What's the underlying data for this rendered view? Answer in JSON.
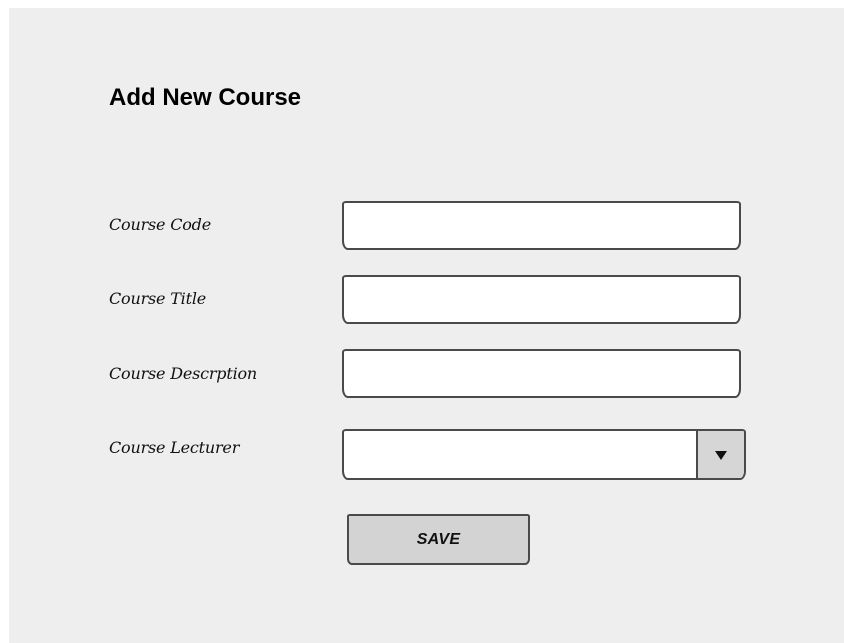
{
  "form": {
    "title": "Add New Course",
    "fields": [
      {
        "label": "Course Code",
        "value": "",
        "type": "text"
      },
      {
        "label": "Course Title",
        "value": "",
        "type": "text"
      },
      {
        "label": "Course Descrption",
        "value": "",
        "type": "text"
      },
      {
        "label": "Course Lecturer",
        "value": "",
        "type": "select",
        "icon": "triangle-down-icon"
      }
    ],
    "save_label": "SAVE"
  },
  "colors": {
    "panel_background": "#eeeeee",
    "input_background": "#ffffff",
    "border": "#4a4a4a",
    "button_background": "#d3d3d3",
    "dropdown_button_background": "#d6d6d6"
  }
}
